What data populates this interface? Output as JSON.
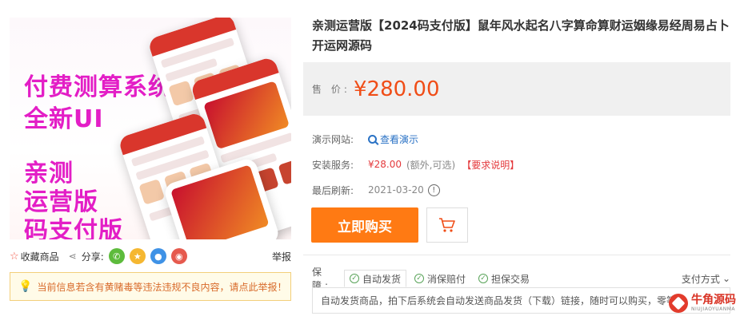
{
  "product_image": {
    "promo_lines": [
      "付费测算系统",
      "全新UI",
      "亲测",
      "运营版",
      "码支付版"
    ]
  },
  "image_actions": {
    "favorite_label": "收藏商品",
    "share_label": "分享:",
    "share_icons": [
      "wechat-icon",
      "qzone-icon",
      "qq-icon",
      "weibo-icon"
    ],
    "report_label": "举报"
  },
  "notice": {
    "text": "当前信息若含有黄赌毒等违法违规不良内容，请点此举报！"
  },
  "product": {
    "title": "亲测运营版【2024码支付版】鼠年风水起名八字算命算财运姻缘易经周易占卜开运网源码",
    "price_label": "售 价:",
    "price": "¥280.00",
    "demo_label": "演示网站:",
    "demo_link": "查看演示",
    "install_label": "安装服务:",
    "install_price": "¥28.00",
    "install_extra": "(额外,可选)",
    "install_requirement": "【要求说明】",
    "refresh_label": "最后刷新:",
    "refresh_date": "2021-03-20",
    "buy_label": "立即购买"
  },
  "guarantee": {
    "label": "保 障:",
    "tags": [
      "自动发货",
      "消保赔付",
      "担保交易"
    ],
    "pay_method": "支付方式",
    "description": "自动发货商品，拍下后系统会自动发送商品发货（下载）链接，随时可以购买，零等待"
  },
  "watermark": {
    "cn": "牛角源码",
    "en": "NIUJIAOYUANMA"
  },
  "colors": {
    "price": "#f04d17",
    "buy_button": "#ff7a13",
    "promo_text": "#e31ec6",
    "link": "#2a72c5",
    "warning": "#e4393c"
  }
}
